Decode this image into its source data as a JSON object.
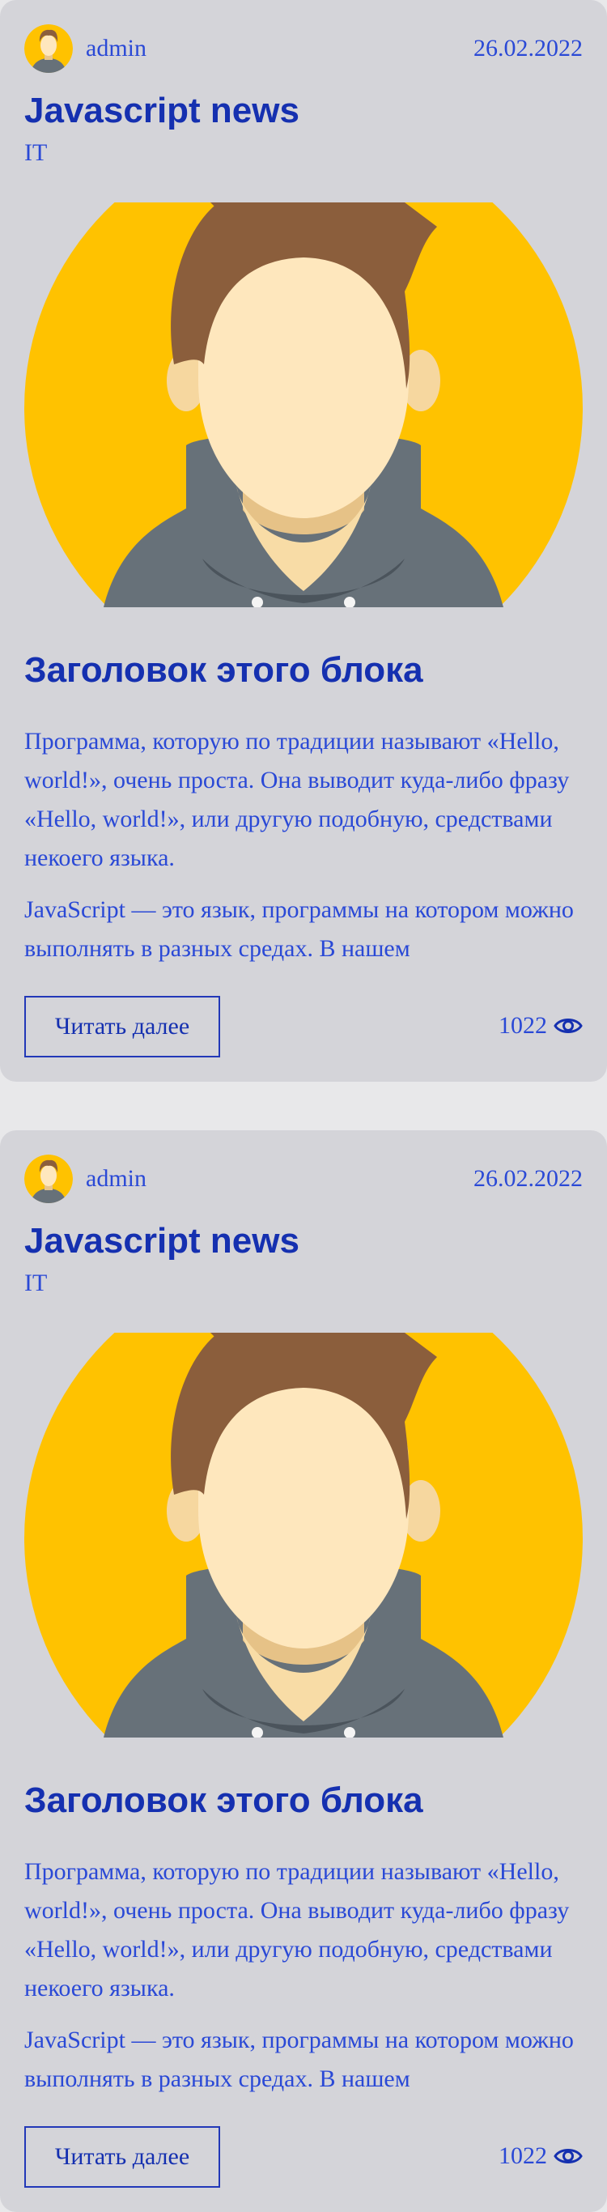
{
  "posts": [
    {
      "author": "admin",
      "date": "26.02.2022",
      "title": "Javascript news",
      "category": "IT",
      "heading": "Заголовок этого блока",
      "paragraphs": [
        "Программа, которую по традиции называют «Hello, world!», очень проста. Она выводит куда-либо фразу «Hello, world!», или другую подобную, средствами некоего языка.",
        "JavaScript — это язык, программы на котором можно выполнять в разных средах. В нашем"
      ],
      "read_more_label": "Читать далее",
      "views": "1022",
      "avatar_icon": "person-avatar-icon",
      "views_icon": "eye-icon"
    },
    {
      "author": "admin",
      "date": "26.02.2022",
      "title": "Javascript news",
      "category": "IT",
      "heading": "Заголовок этого блока",
      "paragraphs": [
        "Программа, которую по традиции называют «Hello, world!», очень проста. Она выводит куда-либо фразу «Hello, world!», или другую подобную, средствами некоего языка.",
        "JavaScript — это язык, программы на котором можно выполнять в разных средах. В нашем"
      ],
      "read_more_label": "Читать далее",
      "views": "1022",
      "avatar_icon": "person-avatar-icon",
      "views_icon": "eye-icon"
    }
  ],
  "colors": {
    "page_background": "#e8e8ea",
    "card_background": "#d4d4d9",
    "text": "#2a49d6",
    "heading": "#1530b0",
    "illustration_background": "#ffc200"
  }
}
